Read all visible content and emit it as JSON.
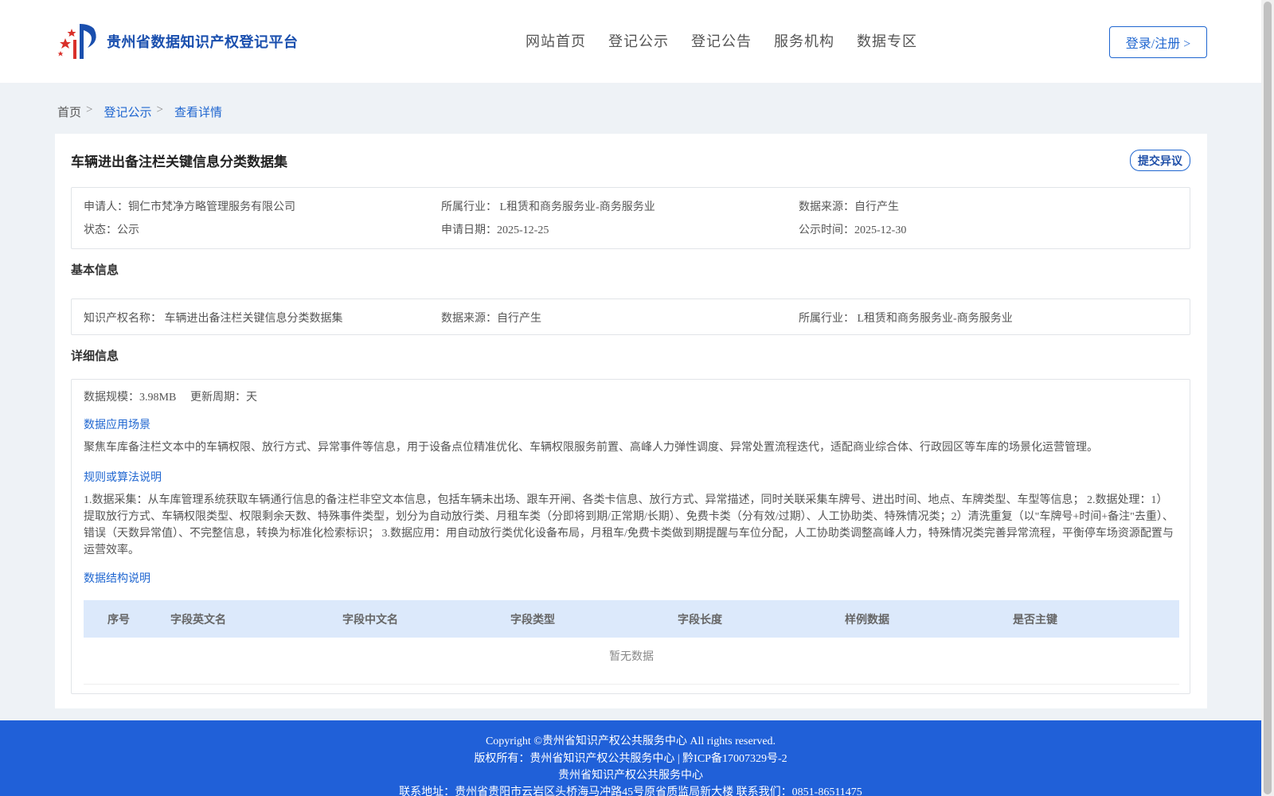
{
  "header": {
    "site_name": "贵州省数据知识产权登记平台",
    "nav": [
      "网站首页",
      "登记公示",
      "登记公告",
      "服务机构",
      "数据专区"
    ],
    "login_label": "登录/注册 >"
  },
  "breadcrumb": {
    "home": "首页",
    "sep": ">",
    "level1": "登记公示",
    "level2": "查看详情"
  },
  "detail": {
    "title": "车辆进出备注栏关键信息分类数据集",
    "objection_label": "提交异议",
    "summary": {
      "applicant_label": "申请人：",
      "applicant": "铜仁市梵净方略管理服务有限公司",
      "industry_label": "所属行业：",
      "industry": "L租赁和商务服务业-商务服务业",
      "source_label": "数据来源：",
      "source": "自行产生",
      "status_label": "状态：",
      "status": "公示",
      "apply_date_label": "申请日期：",
      "apply_date": "2025-12-25",
      "publish_date_label": "公示时间：",
      "publish_date": "2025-12-30"
    },
    "basic": {
      "section_title": "基本信息",
      "ip_name_label": "知识产权名称：",
      "ip_name": "车辆进出备注栏关键信息分类数据集",
      "source_label": "数据来源：",
      "source": "自行产生",
      "industry_label": "所属行业：",
      "industry": "L租赁和商务服务业-商务服务业"
    },
    "info": {
      "section_title": "详细信息",
      "scale_label": "数据规模：",
      "scale": "3.98MB",
      "cycle_label": "更新周期：",
      "cycle": "天",
      "scenario_title": "数据应用场景",
      "scenario_text": "聚焦车库备注栏文本中的车辆权限、放行方式、异常事件等信息，用于设备点位精准优化、车辆权限服务前置、高峰人力弹性调度、异常处置流程迭代，适配商业综合体、行政园区等车库的场景化运营管理。",
      "algorithm_title": "规则或算法说明",
      "algorithm_text": "1.数据采集：从车库管理系统获取车辆通行信息的备注栏非空文本信息，包括车辆未出场、跟车开闸、各类卡信息、放行方式、异常描述，同时关联采集车牌号、进出时间、地点、车牌类型、车型等信息； 2.数据处理：1）提取放行方式、车辆权限类型、权限剩余天数、特殊事件类型，划分为自动放行类、月租车类（分即将到期/正常期/长期）、免费卡类（分有效/过期）、人工协助类、特殊情况类；2）清洗重复（以\"车牌号+时间+备注\"去重）、错误（天数异常值）、不完整信息，转换为标准化检索标识； 3.数据应用：用自动放行类优化设备布局，月租车/免费卡类做到期提醒与车位分配，人工协助类调整高峰人力，特殊情况类完善异常流程，平衡停车场资源配置与运营效率。",
      "structure_title": "数据结构说明",
      "columns": [
        "序号",
        "字段英文名",
        "字段中文名",
        "字段类型",
        "字段长度",
        "样例数据",
        "是否主键"
      ],
      "empty_text": "暂无数据"
    }
  },
  "footer": {
    "copyright": "Copyright ©贵州省知识产权公共服务中心 All rights reserved.",
    "owner": "版权所有：贵州省知识产权公共服务中心 | 黔ICP备17007329号-2",
    "org": "贵州省知识产权公共服务中心",
    "contact": "联系地址：贵州省贵阳市云岩区头桥海马冲路45号原省质监局新大楼 联系我们：0851-86511475"
  },
  "colors": {
    "brand": "#1f66d0",
    "footer_bg": "#2060d8",
    "table_head_bg": "#dce9fb"
  }
}
